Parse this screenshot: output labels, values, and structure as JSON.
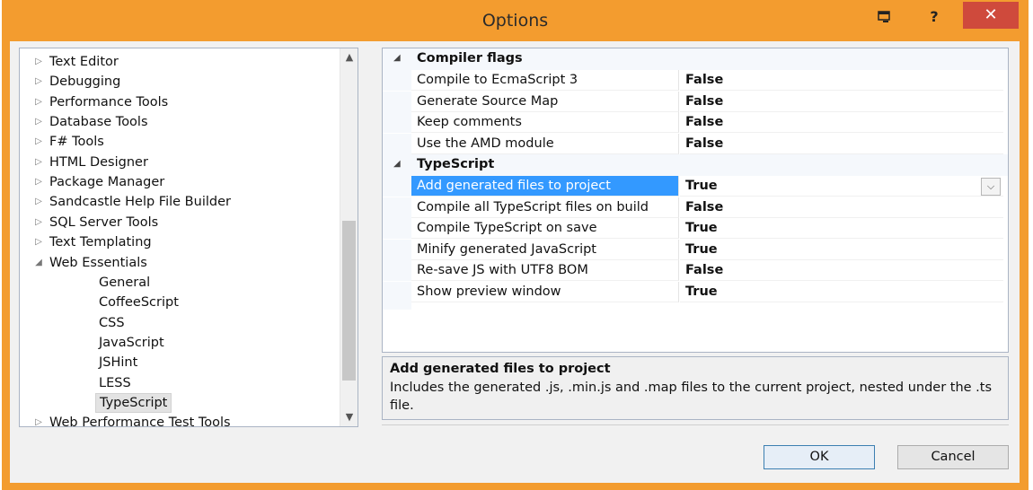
{
  "window": {
    "title": "Options",
    "sysmenu_icon": "window-menu-icon",
    "help_label": "?",
    "close_label": "✕",
    "accent_color": "#f39c2f"
  },
  "tree": {
    "items": [
      {
        "label": "Text Editor",
        "arrow": "▷"
      },
      {
        "label": "Debugging",
        "arrow": "▷"
      },
      {
        "label": "Performance Tools",
        "arrow": "▷"
      },
      {
        "label": "Database Tools",
        "arrow": "▷"
      },
      {
        "label": "F# Tools",
        "arrow": "▷"
      },
      {
        "label": "HTML Designer",
        "arrow": "▷"
      },
      {
        "label": "Package Manager",
        "arrow": "▷"
      },
      {
        "label": "Sandcastle Help File Builder",
        "arrow": "▷"
      },
      {
        "label": "SQL Server Tools",
        "arrow": "▷"
      },
      {
        "label": "Text Templating",
        "arrow": "▷"
      },
      {
        "label": "Web Essentials",
        "arrow": "◢"
      },
      {
        "label": "General"
      },
      {
        "label": "CoffeeScript"
      },
      {
        "label": "CSS"
      },
      {
        "label": "JavaScript"
      },
      {
        "label": "JSHint"
      },
      {
        "label": "LESS"
      },
      {
        "label": "TypeScript",
        "selected": true
      },
      {
        "label": "Web Performance Test Tools",
        "arrow": "▷"
      }
    ],
    "scroll_up": "▲",
    "scroll_down": "▼"
  },
  "grid": {
    "categories": [
      {
        "label": "Compiler flags",
        "arrow": "◢",
        "properties": [
          {
            "name": "Compile to EcmaScript 3",
            "value": "False"
          },
          {
            "name": "Generate Source Map",
            "value": "False"
          },
          {
            "name": "Keep comments",
            "value": "False"
          },
          {
            "name": "Use the AMD module",
            "value": "False"
          }
        ]
      },
      {
        "label": "TypeScript",
        "arrow": "◢",
        "properties": [
          {
            "name": "Add generated files to project",
            "value": "True",
            "selected": true
          },
          {
            "name": "Compile all TypeScript files on build",
            "value": "False"
          },
          {
            "name": "Compile TypeScript on save",
            "value": "True"
          },
          {
            "name": "Minify generated JavaScript",
            "value": "True"
          },
          {
            "name": "Re-save JS with UTF8 BOM",
            "value": "False"
          },
          {
            "name": "Show preview window",
            "value": "True"
          }
        ]
      }
    ],
    "dropdown_glyph": "⌵"
  },
  "description": {
    "title": "Add generated files to project",
    "text": "Includes the generated .js, .min.js and .map files to the current project, nested under the .ts file."
  },
  "buttons": {
    "ok": "OK",
    "cancel": "Cancel"
  }
}
